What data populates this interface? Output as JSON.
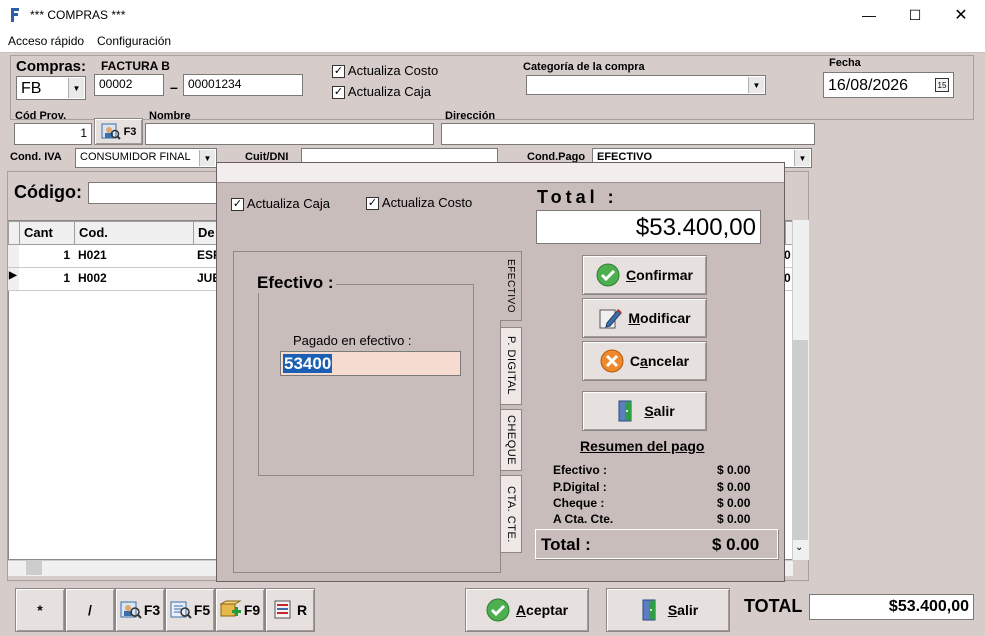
{
  "window": {
    "title": "*** COMPRAS ***"
  },
  "menu": {
    "items": [
      "Acceso rápido",
      "Configuración"
    ]
  },
  "header": {
    "compras_label": "Compras:",
    "tipo": "FB",
    "factura_label": "FACTURA B",
    "punto_venta": "00002",
    "dash": "–",
    "numero": "00001234",
    "actualiza_costo": "Actualiza Costo",
    "actualiza_caja": "Actualiza Caja",
    "categoria_label": "Categoría de la compra",
    "categoria_value": "",
    "fecha_label": "Fecha",
    "fecha_value": "16/08/2026",
    "cod_prov_label": "Cód Prov.",
    "cod_prov_value": "1",
    "f3_label": "F3",
    "nombre_label": "Nombre",
    "nombre_value": "",
    "direccion_label": "Dirección",
    "direccion_value": "",
    "cond_iva_label": "Cond. IVA",
    "cond_iva_value": "CONSUMIDOR FINAL",
    "cuit_label": "Cuit/DNI",
    "cuit_value": "",
    "cond_pago_label": "Cond.Pago",
    "cond_pago_value": "EFECTIVO"
  },
  "codigo": {
    "label": "Código:",
    "value": ""
  },
  "grid": {
    "headers": [
      "Cant",
      "Cod.",
      "De"
    ],
    "rows": [
      {
        "cant": "1",
        "cod": "H021",
        "desc": "ESP",
        "right": "0"
      },
      {
        "cant": "1",
        "cod": "H002",
        "desc": "JUE",
        "right": "0"
      }
    ]
  },
  "dialog": {
    "actualiza_caja": "Actualiza Caja",
    "actualiza_costo": "Actualiza Costo",
    "total_label": "Total :",
    "total_value": "$53.400,00",
    "efectivo_title": "Efectivo :",
    "pagado_label": "Pagado en efectivo :",
    "pagado_value": "53400",
    "tabs": [
      "EFECTIVO",
      "P. DIGITAL",
      "CHEQUE",
      "CTA. CTE."
    ],
    "buttons": {
      "confirmar": {
        "u": "C",
        "rest": "onfirmar"
      },
      "modificar": {
        "u": "M",
        "rest": "odificar"
      },
      "cancelar": {
        "pre": "C",
        "u": "a",
        "rest": "ncelar"
      },
      "salir": {
        "u": "S",
        "rest": "alir"
      }
    },
    "resumen_title": "Resumen del pago",
    "resumen": [
      {
        "label": "Efectivo :",
        "value": "$ 0.00"
      },
      {
        "label": "P.Digital :",
        "value": "$ 0.00"
      },
      {
        "label": "Cheque :",
        "value": "$ 0.00"
      },
      {
        "label": "A Cta. Cte.",
        "value": "$ 0.00"
      }
    ],
    "total_resumen_label": "Total :",
    "total_resumen_value": "$ 0.00"
  },
  "footer": {
    "star": "*",
    "slash": "/",
    "f3": "F3",
    "f5": "F5",
    "f9": "F9",
    "r": "R",
    "aceptar": {
      "u": "A",
      "rest": "ceptar"
    },
    "salir": {
      "u": "S",
      "rest": "alir"
    },
    "total_label": "TOTAL",
    "total_value": "$53.400,00"
  },
  "colors": {
    "form_bg": "#d6cdcb",
    "dialog_bg": "#c9bdbb",
    "highlight": "#1a5fb4",
    "input_pink": "#f6dcd0"
  }
}
